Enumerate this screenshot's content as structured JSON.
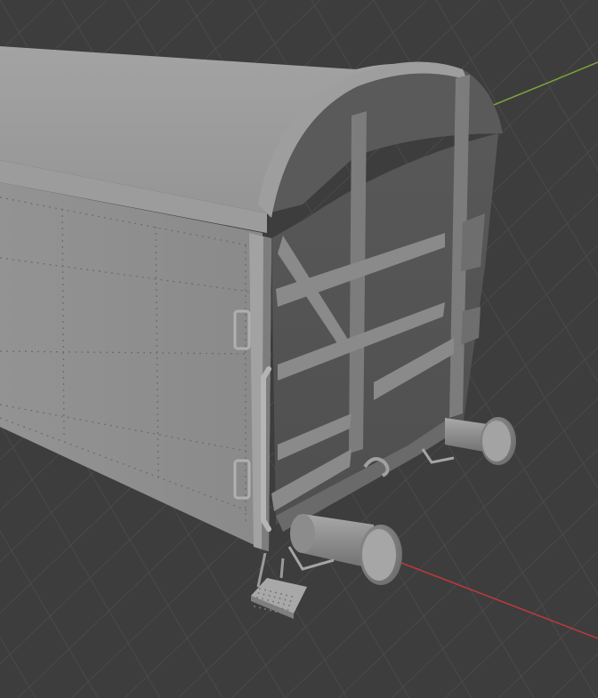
{
  "viewport": {
    "background_color": "#3d3d3d",
    "grid_color": "#4a4a4a",
    "x_axis_color": "#c0393b",
    "y_axis_color": "#7aa33c"
  },
  "model": {
    "body_color": "#8e8e8e",
    "body_light": "#a5a5a5",
    "end_wall_color": "#5e5e5e",
    "frame_color": "#6f6f6f",
    "rivet_color": "#6a6a6a"
  }
}
